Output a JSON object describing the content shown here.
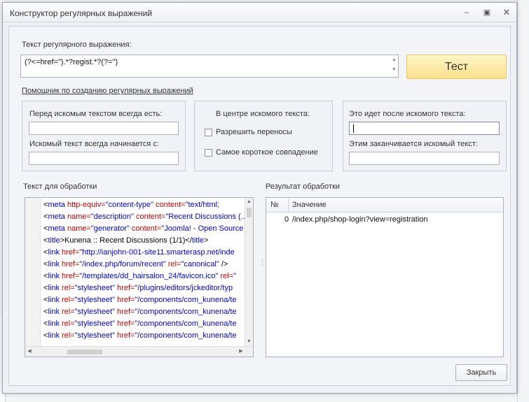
{
  "window": {
    "title": "Конструктор регулярных выражений",
    "minimize_icon": "minimize-icon",
    "maximize_icon": "maximize-icon",
    "close_icon": "close-icon"
  },
  "regex": {
    "label": "Текст регулярного выражения:",
    "value": "(?<=href=\").*?regist.*?(?=\")",
    "test_button": "Тест"
  },
  "helper_link": "Помощник по созданию регулярных выражений",
  "before_group": {
    "before_label": "Перед искомым текстом всегда есть:",
    "before_value": "",
    "starts_label": "Искомый текст всегда начинается с:",
    "starts_value": ""
  },
  "center_group": {
    "title": "В центре искомого текста:",
    "allow_wrap": "Разрешить переносы",
    "shortest_match": "Самое короткое совпадение"
  },
  "after_group": {
    "after_label": "Это идет после искомого текста:",
    "after_value": "",
    "ends_label": "Этим заканчивается искомый текст:",
    "ends_value": ""
  },
  "source": {
    "label": "Текст для обработки",
    "lines": [
      [
        [
          "t",
          "    <"
        ],
        [
          "tag",
          "meta "
        ],
        [
          "attr",
          "http-equiv="
        ],
        [
          "val",
          "\"content-type\""
        ],
        [
          "attr",
          " content="
        ],
        [
          "val",
          "\"text/html;"
        ]
      ],
      [
        [
          "t",
          "<"
        ],
        [
          "tag",
          "meta "
        ],
        [
          "attr",
          "name="
        ],
        [
          "val",
          "\"description\""
        ],
        [
          "attr",
          " content="
        ],
        [
          "val",
          "\"Recent Discussions (..."
        ]
      ],
      [
        [
          "t",
          "<"
        ],
        [
          "tag",
          "meta "
        ],
        [
          "attr",
          "name="
        ],
        [
          "val",
          "\"generator\""
        ],
        [
          "attr",
          " content="
        ],
        [
          "val",
          "\"Joomla! - Open Source"
        ]
      ],
      [
        [
          "t",
          "<"
        ],
        [
          "tag",
          "title"
        ],
        [
          "t",
          ">Kunena :: Recent Discussions (1/1)</"
        ],
        [
          "tag",
          "title"
        ],
        [
          "t",
          ">"
        ]
      ],
      [
        [
          "t",
          "<"
        ],
        [
          "tag",
          "link "
        ],
        [
          "attr",
          "href="
        ],
        [
          "val",
          "\"http://ianjohn-001-site11.smarterasp.net/inde"
        ]
      ],
      [
        [
          "t",
          "<"
        ],
        [
          "tag",
          "link "
        ],
        [
          "attr",
          "href="
        ],
        [
          "val",
          "\"/index.php/forum/recent\""
        ],
        [
          "attr",
          " rel="
        ],
        [
          "val",
          "\"canonical\""
        ],
        [
          "t",
          " />"
        ]
      ],
      [
        [
          "t",
          "<"
        ],
        [
          "tag",
          "link "
        ],
        [
          "attr",
          "href="
        ],
        [
          "val",
          "\"/templates/dd_hairsalon_24/favicon.ico\""
        ],
        [
          "attr",
          " rel="
        ],
        [
          "val",
          "\""
        ]
      ],
      [
        [
          "t",
          "<"
        ],
        [
          "tag",
          "link "
        ],
        [
          "attr",
          "rel="
        ],
        [
          "val",
          "\"stylesheet\""
        ],
        [
          "attr",
          " href="
        ],
        [
          "val",
          "\"/plugins/editors/jckeditor/typ"
        ]
      ],
      [
        [
          "t",
          "<"
        ],
        [
          "tag",
          "link "
        ],
        [
          "attr",
          "rel="
        ],
        [
          "val",
          "\"stylesheet\""
        ],
        [
          "attr",
          " href="
        ],
        [
          "val",
          "\"/components/com_kunena/te"
        ]
      ],
      [
        [
          "t",
          "<"
        ],
        [
          "tag",
          "link "
        ],
        [
          "attr",
          "rel="
        ],
        [
          "val",
          "\"stylesheet\""
        ],
        [
          "attr",
          " href="
        ],
        [
          "val",
          "\"/components/com_kunena/te"
        ]
      ],
      [
        [
          "t",
          "<"
        ],
        [
          "tag",
          "link "
        ],
        [
          "attr",
          "rel="
        ],
        [
          "val",
          "\"stylesheet\""
        ],
        [
          "attr",
          " href="
        ],
        [
          "val",
          "\"/components/com_kunena/te"
        ]
      ],
      [
        [
          "t",
          "<"
        ],
        [
          "tag",
          "link "
        ],
        [
          "attr",
          "rel="
        ],
        [
          "val",
          "\"stylesheet\""
        ],
        [
          "attr",
          " href="
        ],
        [
          "val",
          "\"/components/com_kunena/te"
        ]
      ]
    ]
  },
  "result": {
    "label": "Результат обработки",
    "col_num": "№",
    "col_value": "Значение",
    "rows": [
      {
        "num": "0",
        "value": "/index.php/shop-login?view=registration"
      }
    ]
  },
  "close_button": "Закрыть"
}
